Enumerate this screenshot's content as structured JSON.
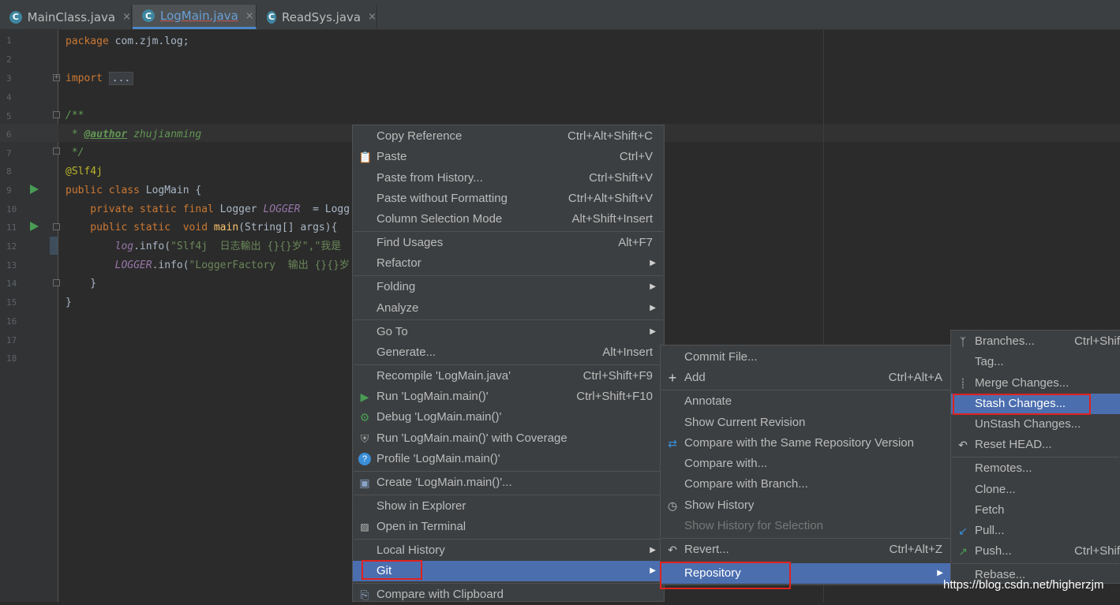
{
  "tabs": [
    {
      "label": "MainClass.java",
      "icon": "C",
      "close": "×"
    },
    {
      "label": "LogMain.java",
      "icon": "C",
      "close": "×"
    },
    {
      "label": "ReadSys.java",
      "icon": "C",
      "close": "×"
    }
  ],
  "line_numbers": [
    "1",
    "2",
    "3",
    "4",
    "5",
    "6",
    "7",
    "8",
    "9",
    "10",
    "11",
    "12",
    "13",
    "14",
    "15",
    "16",
    "17",
    "18"
  ],
  "code": {
    "l1_kw": "package",
    "l1_rest": " com.zjm.log;",
    "l3_kw": "import",
    "l3_fold": "...",
    "l7": "/**",
    "l8_star": " * ",
    "l8_tag": "@author",
    "l8_name": " zhujianming",
    "l9": " */",
    "l10": "@Slf4j",
    "l11_kw": "public class",
    "l11_rest": " LogMain {",
    "l12_kw": "    private static final",
    "l12_type": " Logger ",
    "l12_field": "LOGGER",
    "l12_rest": "  = Logg",
    "l13_kw": "    public static",
    "l13_void": "  void ",
    "l13_fn": "main",
    "l13_rest": "(String[] args){",
    "l14_obj": "        log",
    "l14_call": ".info(",
    "l14_str": "\"Slf4j  日志輸出 {}{}岁\",\"我是",
    "l15_obj": "        LOGGER",
    "l15_call": ".info(",
    "l15_str": "\"LoggerFactory  输出 {}{}岁",
    "l16": "    }",
    "l17": "}"
  },
  "context_menu": [
    {
      "label": "Copy Reference",
      "shortcut": "Ctrl+Alt+Shift+C"
    },
    {
      "label": "Paste",
      "shortcut": "Ctrl+V",
      "icon": "paste-icon"
    },
    {
      "label": "Paste from History...",
      "shortcut": "Ctrl+Shift+V"
    },
    {
      "label": "Paste without Formatting",
      "shortcut": "Ctrl+Alt+Shift+V"
    },
    {
      "label": "Column Selection Mode",
      "shortcut": "Alt+Shift+Insert"
    },
    {
      "label": "Find Usages",
      "shortcut": "Alt+F7"
    },
    {
      "label": "Refactor",
      "shortcut": ""
    },
    {
      "label": "Folding",
      "shortcut": ""
    },
    {
      "label": "Analyze",
      "shortcut": ""
    },
    {
      "label": "Go To",
      "shortcut": ""
    },
    {
      "label": "Generate...",
      "shortcut": "Alt+Insert"
    },
    {
      "label": "Recompile 'LogMain.java'",
      "shortcut": "Ctrl+Shift+F9"
    },
    {
      "label": "Run 'LogMain.main()'",
      "shortcut": "Ctrl+Shift+F10",
      "icon": "run-icon"
    },
    {
      "label": "Debug 'LogMain.main()'",
      "shortcut": "",
      "icon": "debug-icon"
    },
    {
      "label": "Run 'LogMain.main()' with Coverage",
      "shortcut": "",
      "icon": "coverage-icon"
    },
    {
      "label": "Profile 'LogMain.main()'",
      "shortcut": "",
      "icon": "profile-icon"
    },
    {
      "label": "Create 'LogMain.main()'...",
      "shortcut": "",
      "icon": "create-config-icon"
    },
    {
      "label": "Show in Explorer",
      "shortcut": ""
    },
    {
      "label": "Open in Terminal",
      "shortcut": "",
      "icon": "terminal-icon"
    },
    {
      "label": "Local History",
      "shortcut": ""
    },
    {
      "label": "Git",
      "shortcut": ""
    },
    {
      "label": "Compare with Clipboard",
      "shortcut": "",
      "icon": "compare-clipboard-icon"
    }
  ],
  "git_menu": [
    {
      "label": "Commit File...",
      "shortcut": ""
    },
    {
      "label": "Add",
      "shortcut": "Ctrl+Alt+A",
      "icon": "add-icon"
    },
    {
      "label": "Annotate",
      "shortcut": ""
    },
    {
      "label": "Show Current Revision",
      "shortcut": ""
    },
    {
      "label": "Compare with the Same Repository Version",
      "shortcut": "",
      "icon": "compare-icon"
    },
    {
      "label": "Compare with...",
      "shortcut": ""
    },
    {
      "label": "Compare with Branch...",
      "shortcut": ""
    },
    {
      "label": "Show History",
      "shortcut": "",
      "icon": "history-icon"
    },
    {
      "label": "Show History for Selection",
      "shortcut": ""
    },
    {
      "label": "Revert...",
      "shortcut": "Ctrl+Alt+Z",
      "icon": "revert-icon"
    },
    {
      "label": "Repository",
      "shortcut": ""
    }
  ],
  "repository_menu": [
    {
      "label": "Branches...",
      "shortcut": "Ctrl+Shif",
      "icon": "branch-icon"
    },
    {
      "label": "Tag...",
      "shortcut": ""
    },
    {
      "label": "Merge Changes...",
      "shortcut": "",
      "icon": "merge-icon"
    },
    {
      "label": "Stash Changes...",
      "shortcut": ""
    },
    {
      "label": "UnStash Changes...",
      "shortcut": ""
    },
    {
      "label": "Reset HEAD...",
      "shortcut": "",
      "icon": "reset-icon"
    },
    {
      "label": "Remotes...",
      "shortcut": ""
    },
    {
      "label": "Clone...",
      "shortcut": ""
    },
    {
      "label": "Fetch",
      "shortcut": ""
    },
    {
      "label": "Pull...",
      "shortcut": "",
      "icon": "pull-icon"
    },
    {
      "label": "Push...",
      "shortcut": "Ctrl+Shif",
      "icon": "push-icon"
    },
    {
      "label": "Rebase...",
      "shortcut": ""
    }
  ],
  "watermark": "https://blog.csdn.net/higherzjm",
  "colors": {
    "selection": "#4b6eaf",
    "highlight_box": "#e0221f",
    "menu_bg": "#3c3f41",
    "editor_bg": "#2b2b2b"
  }
}
